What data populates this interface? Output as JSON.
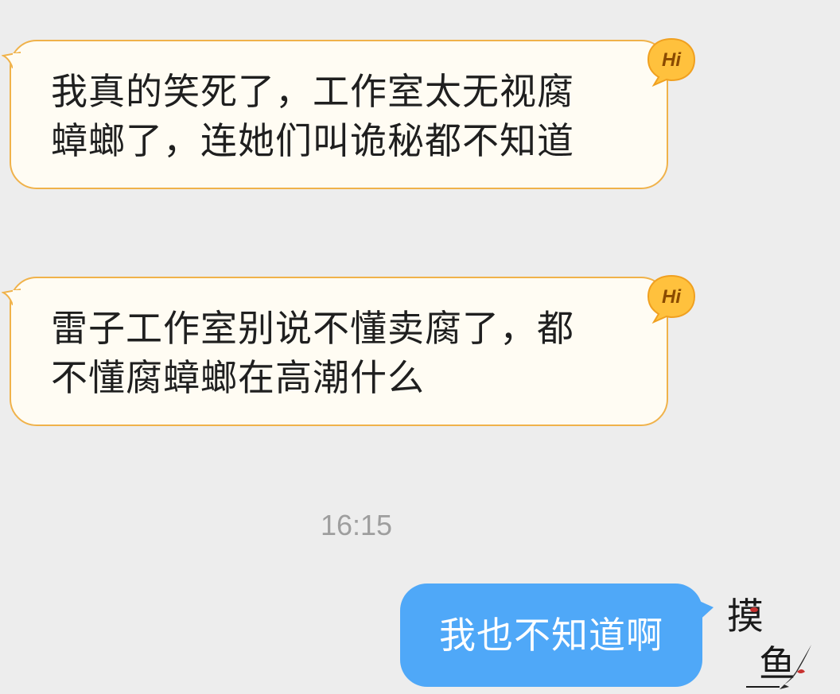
{
  "messages_in": [
    {
      "lines": [
        "我真的笑死了，工作室太无视腐",
        "蟑螂了，连她们叫诡秘都不知道"
      ],
      "badge_label": "Hi"
    },
    {
      "lines": [
        "雷子工作室别说不懂卖腐了，都",
        "不懂腐蟑螂在高潮什么"
      ],
      "badge_label": "Hi"
    }
  ],
  "timestamp": "16:15",
  "message_out": {
    "text": "我也不知道啊"
  },
  "avatar": {
    "icon": "calligraphy-fish-avatar-icon",
    "glyph_top": "摸",
    "glyph_bottom": "鱼"
  },
  "colors": {
    "background": "#EDEDED",
    "incoming_bubble": "#FFFCF3",
    "incoming_border": "#F0B24A",
    "badge": "#FFC13D",
    "outgoing_bubble": "#4FA8F8",
    "timestamp": "#9E9E9E"
  }
}
